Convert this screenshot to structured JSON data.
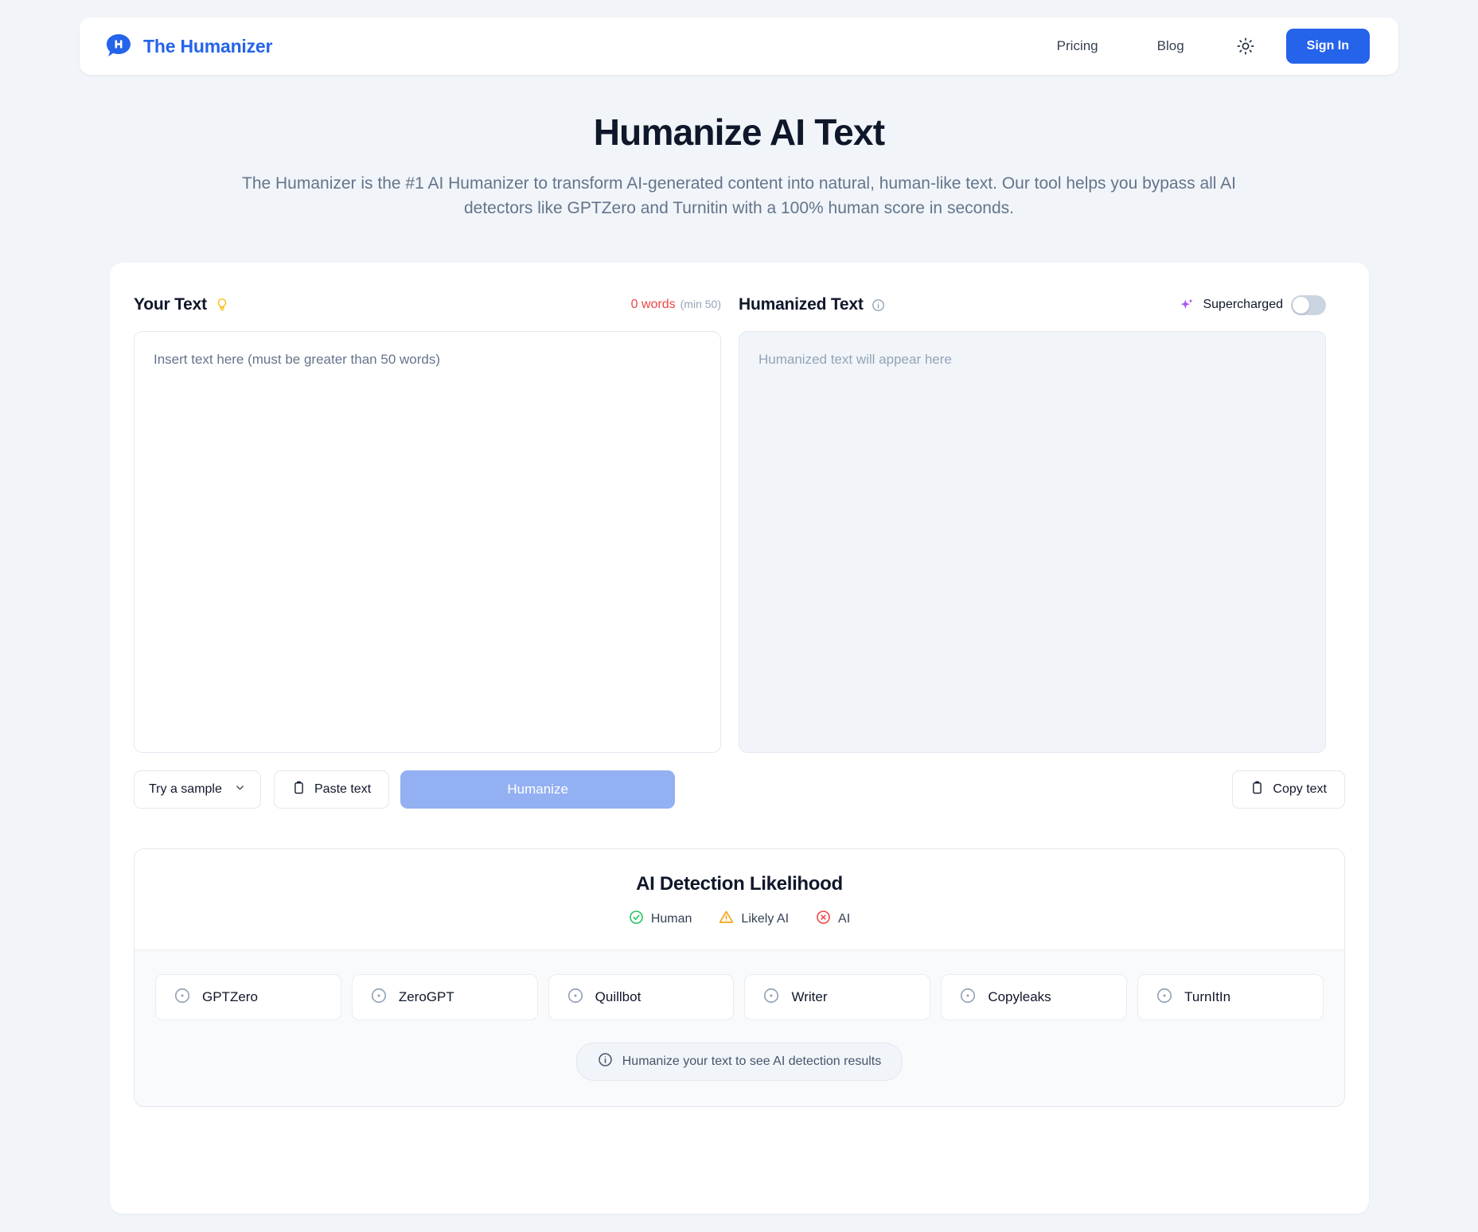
{
  "header": {
    "brand_name": "The Humanizer",
    "logo_letter": "H",
    "nav": [
      {
        "label": "Pricing",
        "name": "nav-link-pricing"
      },
      {
        "label": "Blog",
        "name": "nav-link-blog"
      }
    ],
    "theme_toggle_icon": "sun-icon",
    "signin_label": "Sign In"
  },
  "hero": {
    "title": "Humanize AI Text",
    "subtitle": "The Humanizer is the #1 AI Humanizer to transform AI-generated content into natural, human-like text. Our tool helps you bypass all AI detectors like GPTZero and Turnitin with a 100% human score in seconds."
  },
  "editor": {
    "input": {
      "title": "Your Text",
      "title_icon": "lightbulb-icon",
      "word_count": "0 words",
      "word_minimum": "(min 50)",
      "placeholder": "Insert text here (must be greater than 50 words)",
      "value": ""
    },
    "output": {
      "title": "Humanized Text",
      "title_icon": "info-icon",
      "supercharged_label": "Supercharged",
      "supercharged_icon": "sparkle-icon",
      "supercharged_on": false,
      "placeholder": "Humanized text will appear here",
      "value": ""
    }
  },
  "actions": {
    "try_sample_label": "Try a sample",
    "try_sample_icon": "chevron-down-icon",
    "paste_label": "Paste text",
    "paste_icon": "clipboard-icon",
    "humanize_label": "Humanize",
    "humanize_disabled": true,
    "copy_label": "Copy text",
    "copy_icon": "clipboard-icon"
  },
  "detection": {
    "title": "AI Detection Likelihood",
    "legend": [
      {
        "label": "Human",
        "icon": "check-circle-icon",
        "color": "#22c55e"
      },
      {
        "label": "Likely AI",
        "icon": "warning-triangle-icon",
        "color": "#f59e0b"
      },
      {
        "label": "AI",
        "icon": "x-circle-icon",
        "color": "#ef4444"
      }
    ],
    "detectors": [
      {
        "label": "GPTZero",
        "icon": "target-circle-icon"
      },
      {
        "label": "ZeroGPT",
        "icon": "target-circle-icon"
      },
      {
        "label": "Quillbot",
        "icon": "target-circle-icon"
      },
      {
        "label": "Writer",
        "icon": "target-circle-icon"
      },
      {
        "label": "Copyleaks",
        "icon": "target-circle-icon"
      },
      {
        "label": "TurnItIn",
        "icon": "target-circle-icon"
      }
    ],
    "status_text": "Humanize your text to see AI detection results",
    "status_icon": "info-circle-icon"
  },
  "colors": {
    "brand_blue": "#2563eb",
    "page_bg": "#f1f5f9",
    "humanize_disabled": "#93b0f2",
    "word_count_red": "#ef4444",
    "sparkle_purple": "#a855f7",
    "bulb_yellow": "#fbbf24"
  }
}
